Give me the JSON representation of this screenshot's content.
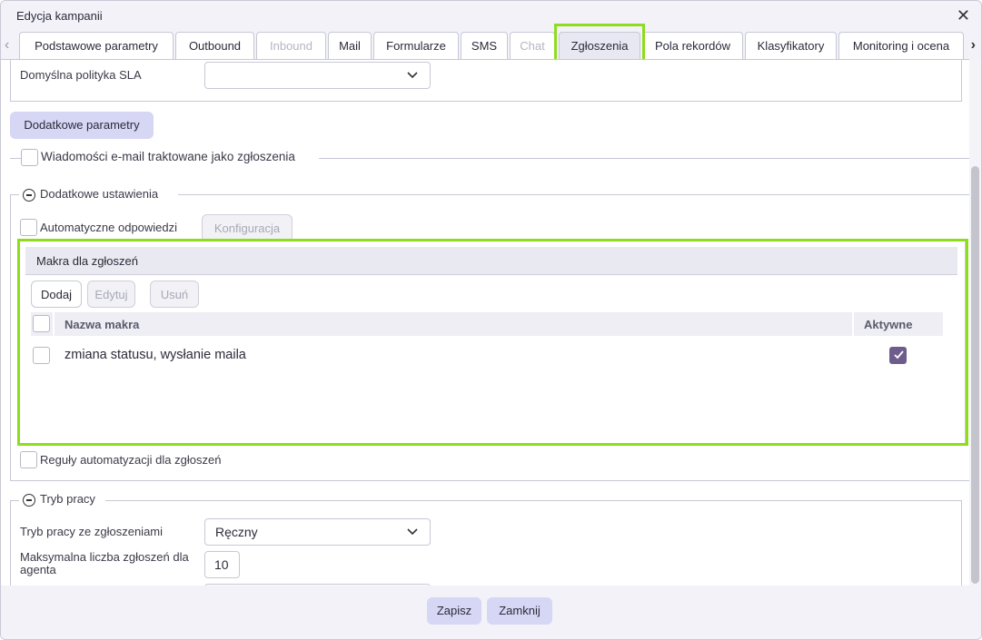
{
  "window": {
    "title": "Edycja kampanii"
  },
  "tabs": [
    {
      "label": "Podstawowe parametry",
      "state": "normal"
    },
    {
      "label": "Outbound",
      "state": "normal"
    },
    {
      "label": "Inbound",
      "state": "disabled"
    },
    {
      "label": "Mail",
      "state": "normal"
    },
    {
      "label": "Formularze",
      "state": "normal"
    },
    {
      "label": "SMS",
      "state": "normal"
    },
    {
      "label": "Chat",
      "state": "disabled"
    },
    {
      "label": "Zgłoszenia",
      "state": "active"
    },
    {
      "label": "Pola rekordów",
      "state": "normal"
    },
    {
      "label": "Klasyfikatory",
      "state": "normal"
    },
    {
      "label": "Monitoring i ocena",
      "state": "normal"
    }
  ],
  "sla": {
    "label": "Domyślna polityka SLA",
    "value": ""
  },
  "additional_params_button": "Dodatkowe parametry",
  "email_as_tickets": {
    "label": "Wiadomości e-mail traktowane jako zgłoszenia",
    "checked": false
  },
  "additional_settings": {
    "legend": "Dodatkowe ustawienia",
    "auto_replies": {
      "label": "Automatyczne odpowiedzi",
      "checked": false
    },
    "config_button": "Konfiguracja",
    "automation_rules": {
      "label": "Reguły automatyzacji dla zgłoszeń",
      "checked": false
    }
  },
  "macros": {
    "title": "Makra dla zgłoszeń",
    "add_button": "Dodaj",
    "edit_button": "Edytuj",
    "delete_button": "Usuń",
    "columns": {
      "name": "Nazwa makra",
      "active": "Aktywne"
    },
    "rows": [
      {
        "name": "zmiana statusu, wysłanie maila",
        "active": true
      }
    ]
  },
  "work_mode": {
    "legend": "Tryb pracy",
    "mode_label": "Tryb pracy ze zgłoszeniami",
    "mode_value": "Ręczny",
    "max_label": "Maksymalna liczba zgłoszeń dla agenta",
    "max_value": "10"
  },
  "footer": {
    "save_button": "Zapisz",
    "close_button": "Zamknij"
  },
  "colors": {
    "accent_highlight": "#8fdc1f",
    "button_lavender": "#d6d6f5",
    "checkbox_checked": "#6e5d8c"
  }
}
